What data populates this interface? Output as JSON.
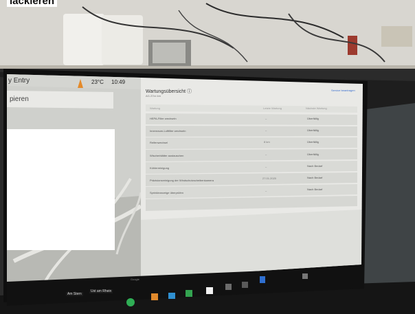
{
  "caption": "lackieren",
  "status_bar": {
    "entry_label": "y Entry",
    "temperature": "23°C",
    "time": "10:49"
  },
  "map": {
    "search_partial": "pieren",
    "bottom_label_1": "Am Stern",
    "bottom_label_2": "Ust am Rhein",
    "corner_label": "Google"
  },
  "panel": {
    "title": "Wartungsübersicht ⓘ",
    "subtitle": "AG-37xx km",
    "link": "Service beantragen",
    "columns": [
      "Wartung",
      "Letzte Wartung",
      "Nächste Wartung"
    ],
    "rows": [
      {
        "name": "HEPA-Filter wechseln",
        "last": "–",
        "next": "Überfällig"
      },
      {
        "name": "Innenraum-Luftfilter wechseln",
        "last": "–",
        "next": "Überfällig"
      },
      {
        "name": "Reifenwechsel",
        "last": "8 km",
        "next": "Überfällig"
      },
      {
        "name": "Wischerblätter austauschen",
        "last": "–",
        "next": "Überfällig"
      },
      {
        "name": "Kühlerreinigung",
        "last": "–",
        "next": "Nach Bedarf"
      },
      {
        "name": "Präzisionsreinigung der Windschutzscheibenkamera",
        "last": "27.01.2020",
        "next": "Nach Bedarf"
      },
      {
        "name": "Sprinkleanzeige überprüfen",
        "last": "–",
        "next": "Nach Bedarf"
      }
    ]
  },
  "taskbar": {
    "icons": [
      "phone-icon",
      "media-icon",
      "app-icon",
      "green-app-icon",
      "calendar-icon",
      "energy-icon",
      "games-icon",
      "bluetooth-icon",
      "volume-icon"
    ]
  }
}
